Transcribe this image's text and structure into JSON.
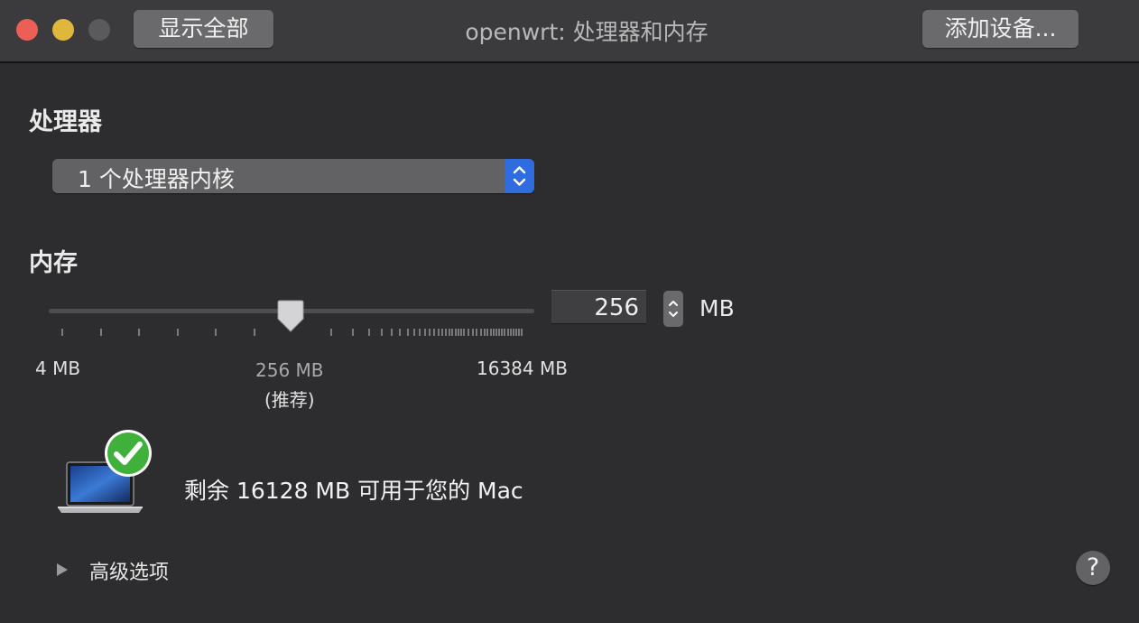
{
  "window": {
    "title": "openwrt: 处理器和内存",
    "show_all_label": "显示全部",
    "add_device_label": "添加设备..."
  },
  "processor": {
    "heading": "处理器",
    "selected": "1 个处理器内核"
  },
  "memory": {
    "heading": "内存",
    "min_label": "4 MB",
    "recommended_value": "256 MB",
    "recommended_note": "(推荐)",
    "max_label": "16384 MB",
    "value": "256",
    "unit": "MB",
    "slider_min_mb": 4,
    "slider_max_mb": 16384,
    "slider_value_mb": 256
  },
  "status": {
    "remaining": "剩余 16128 MB 可用于您的 Mac"
  },
  "advanced": {
    "label": "高级选项"
  },
  "help": {
    "label": "?"
  },
  "colors": {
    "popup_accent": "#2f6ce0",
    "check_green": "#3fb13b"
  },
  "icons": {
    "close": "close-icon",
    "minimize": "minimize-icon",
    "zoom": "zoom-icon",
    "popup_arrows": "chevron-up-down-icon",
    "slider_thumb": "slider-thumb-icon",
    "stepper": "stepper-icon",
    "laptop": "laptop-icon",
    "check": "checkmark-icon",
    "disclosure": "disclosure-triangle-icon"
  }
}
